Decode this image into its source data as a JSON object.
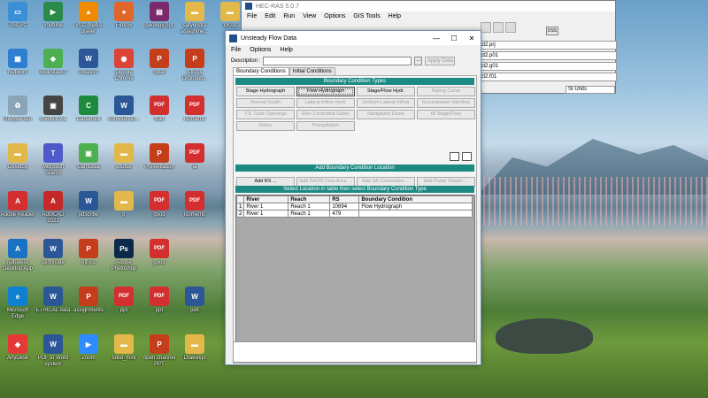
{
  "desktop": {
    "icons": [
      {
        "label": "This PC",
        "icon": "pc-icon",
        "color": "#3a8fd6"
      },
      {
        "label": "Youtube",
        "icon": "youtube-icon",
        "color": "#2a8a4a"
      },
      {
        "label": "VLC media player",
        "icon": "vlc-icon",
        "color": "#f08a00"
      },
      {
        "label": "Firefox",
        "icon": "firefox-icon",
        "color": "#e0662a"
      },
      {
        "label": "geology ppt",
        "icon": "ppt-file-icon",
        "color": "#7a2a6a"
      },
      {
        "label": "satyendra assignme...",
        "icon": "folder-icon",
        "color": "#e2b84a"
      },
      {
        "label": "19030",
        "icon": "folder-icon",
        "color": "#e2b84a"
      },
      {
        "label": "Network",
        "icon": "network-icon",
        "color": "#2f7fd0"
      },
      {
        "label": "BlueStacks",
        "icon": "bluestacks-icon",
        "color": "#4caf50"
      },
      {
        "label": "initiative",
        "icon": "word-icon",
        "color": "#2b5797"
      },
      {
        "label": "Google Chrome",
        "icon": "chrome-icon",
        "color": "#db4437"
      },
      {
        "label": "nptel",
        "icon": "ppt-icon",
        "color": "#c43e1c"
      },
      {
        "label": "Stress Distributi...",
        "icon": "ppt-icon",
        "color": "#c43e1c"
      },
      {
        "label": "Recycle Bin",
        "icon": "recycle-bin-icon",
        "color": "#8aa4b8"
      },
      {
        "label": "oreotv1.9.1",
        "icon": "app-icon",
        "color": "#444"
      },
      {
        "label": "Careerwill",
        "icon": "careerwill-icon",
        "color": "#1e8a3e"
      },
      {
        "label": "conscientio...",
        "icon": "word-icon",
        "color": "#2b5797"
      },
      {
        "label": "fluid",
        "icon": "pdf-icon",
        "color": "#d32f2f"
      },
      {
        "label": "isometric",
        "icon": "pdf-icon",
        "color": "#d32f2f"
      },
      {
        "label": "Desktop",
        "icon": "folder-icon",
        "color": "#e2b84a"
      },
      {
        "label": "Microsoft Teams",
        "icon": "teams-icon",
        "color": "#5059c9"
      },
      {
        "label": "Camtasia",
        "icon": "app-icon",
        "color": "#4caf50"
      },
      {
        "label": "shutter",
        "icon": "folder-icon",
        "color": "#e2b84a"
      },
      {
        "label": "Presentation",
        "icon": "ppt-icon",
        "color": "#c43e1c"
      },
      {
        "label": "ia",
        "icon": "pdf-icon",
        "color": "#d32f2f"
      },
      {
        "label": "Adobe Reader",
        "icon": "adobe-reader-icon",
        "color": "#d32f2f"
      },
      {
        "label": "AutoCAD 2021",
        "icon": "autocad-icon",
        "color": "#c62828"
      },
      {
        "label": "pdscribe",
        "icon": "word-icon",
        "color": "#2b5797"
      },
      {
        "label": "tr",
        "icon": "folder-icon",
        "color": "#e2b84a"
      },
      {
        "label": "good",
        "icon": "pdf-icon",
        "color": "#d32f2f"
      },
      {
        "label": "isometric",
        "icon": "pdf-icon",
        "color": "#d32f2f"
      },
      {
        "label": "Autodesk Desktop App",
        "icon": "autodesk-icon",
        "color": "#1a73c2"
      },
      {
        "label": "certificate",
        "icon": "word-icon",
        "color": "#2b5797"
      },
      {
        "label": "ethics",
        "icon": "ppt-icon",
        "color": "#c43e1c"
      },
      {
        "label": "Adobe Photoshop",
        "icon": "photoshop-icon",
        "color": "#0b2a4a"
      },
      {
        "label": "good",
        "icon": "pdf-icon",
        "color": "#d32f2f"
      },
      {
        "label": "Microsoft Edge",
        "icon": "edge-icon",
        "color": "#0f7fd0"
      },
      {
        "label": "ETHICAL data",
        "icon": "word-icon",
        "color": "#2b5797"
      },
      {
        "label": "assignments",
        "icon": "ppt-icon",
        "color": "#c43e1c"
      },
      {
        "label": "ppt",
        "icon": "pdf-icon",
        "color": "#d32f2f"
      },
      {
        "label": "ppt",
        "icon": "pdf-icon",
        "color": "#d32f2f"
      },
      {
        "label": "plot",
        "icon": "word-icon",
        "color": "#2b5797"
      },
      {
        "label": "AnyDesk",
        "icon": "anydesk-icon",
        "color": "#e53935"
      },
      {
        "label": "PDF to Word system",
        "icon": "word-icon",
        "color": "#2b5797"
      },
      {
        "label": "Zoom",
        "icon": "zoom-icon",
        "color": "#2d8cff"
      },
      {
        "label": "solid_mini",
        "icon": "folder-icon",
        "color": "#e2b84a"
      },
      {
        "label": "open channel PPT",
        "icon": "ppt-icon",
        "color": "#c43e1c"
      },
      {
        "label": "Drawings",
        "icon": "folder-icon",
        "color": "#e2b84a"
      }
    ]
  },
  "main_window": {
    "title": "HEC-RAS 5.0.7",
    "menu": [
      "File",
      "Edit",
      "Run",
      "View",
      "Options",
      "GIS Tools",
      "Help"
    ],
    "dss_label": "DSS",
    "fields": [
      "ect2.prj",
      "ect2.p01",
      "ect2.g01",
      "ect2.f01"
    ],
    "units": "SI Units"
  },
  "dialog": {
    "title": "Unsteady Flow Data",
    "menu": [
      "File",
      "Options",
      "Help"
    ],
    "minimize": "—",
    "maximize": "☐",
    "close": "✕",
    "description_label": "Description :",
    "description_value": "",
    "dots": "...",
    "apply_label": "Apply Data",
    "tabs": [
      "Boundary Conditions",
      "Initial Conditions"
    ],
    "bc_types_header": "Boundary Condition Types",
    "bc_types": [
      {
        "label": "Stage Hydrograph",
        "state": "enabled"
      },
      {
        "label": "Flow Hydrograph",
        "state": "selected"
      },
      {
        "label": "Stage/Flow Hydr.",
        "state": "enabled"
      },
      {
        "label": "Rating Curve",
        "state": "disabled"
      },
      {
        "label": "Normal Depth",
        "state": "disabled"
      },
      {
        "label": "Lateral Inflow Hydr.",
        "state": "disabled"
      },
      {
        "label": "Uniform Lateral Inflow",
        "state": "disabled"
      },
      {
        "label": "Groundwater Interflow",
        "state": "disabled"
      },
      {
        "label": "T.S. Gate Openings",
        "state": "disabled"
      },
      {
        "label": "Elev Controlled Gates",
        "state": "disabled"
      },
      {
        "label": "Navigation Dams",
        "state": "disabled"
      },
      {
        "label": "IB Stage/Flow",
        "state": "disabled"
      },
      {
        "label": "Rules",
        "state": "disabled"
      },
      {
        "label": "Precipitation",
        "state": "disabled"
      }
    ],
    "add_location_header": "Add Boundary Condition Location",
    "add_buttons": [
      {
        "label": "Add RS ...",
        "state": "enabled"
      },
      {
        "label": "Add SA/2D Flow Area ...",
        "state": "disabled"
      },
      {
        "label": "Add SA Connection ...",
        "state": "disabled"
      },
      {
        "label": "Add Pump Station ...",
        "state": "disabled"
      }
    ],
    "table_header_bar": "Select Location in table then select Boundary Condition Type",
    "table": {
      "columns": [
        "River",
        "Reach",
        "RS",
        "Boundary Condition"
      ],
      "rows": [
        {
          "num": "1",
          "river": "River 1",
          "reach": "Reach 1",
          "rs": "10694",
          "bc": "Flow Hydrograph"
        },
        {
          "num": "2",
          "river": "River 1",
          "reach": "Reach 1",
          "rs": "479",
          "bc": ""
        }
      ]
    }
  }
}
